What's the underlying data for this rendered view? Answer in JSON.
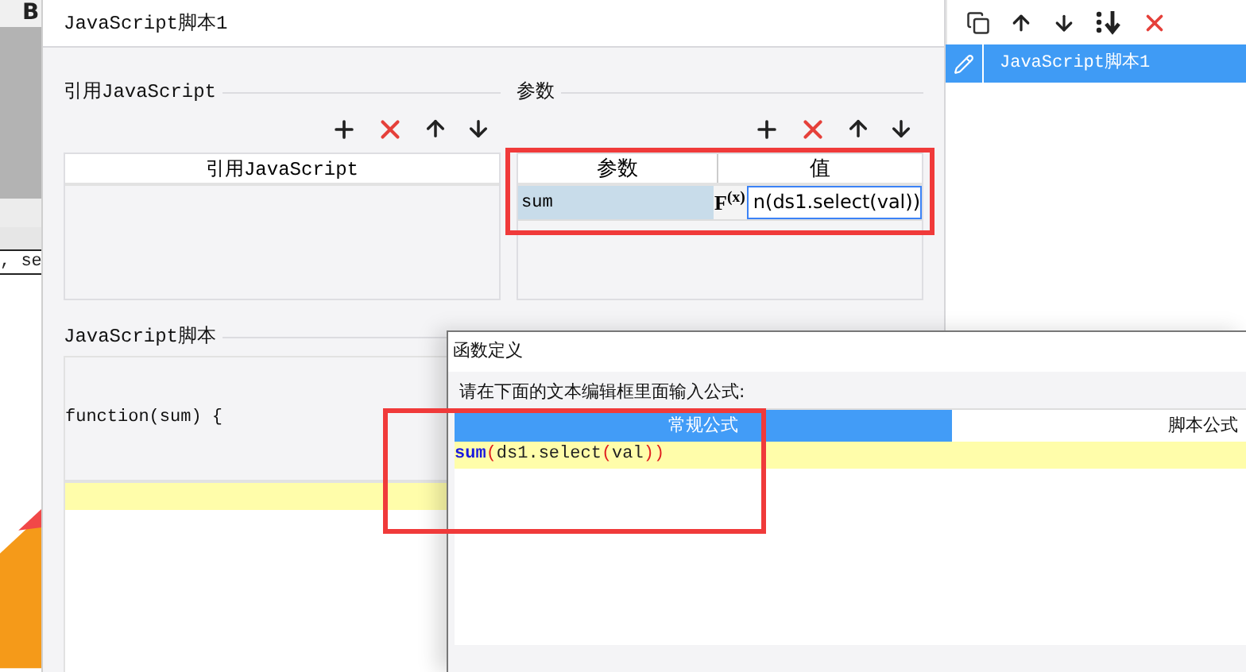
{
  "background_app": {
    "toolbar_letter": "B",
    "text_fragment": ", se"
  },
  "script_dialog": {
    "title": "JavaScript脚本1",
    "references": {
      "legend": "引用JavaScript",
      "columns": [
        "引用JavaScript"
      ]
    },
    "parameters": {
      "legend": "参数",
      "columns": [
        "参数",
        "值"
      ],
      "fx_label": "F$^{(x)}$",
      "rows": [
        {
          "name": "sum",
          "value": "n(ds1.select(val))",
          "selected": true
        }
      ]
    },
    "script": {
      "legend": "JavaScript脚本",
      "header_line": "function(sum) {"
    }
  },
  "script_list": {
    "items": [
      {
        "label": "JavaScript脚本1",
        "selected": true
      }
    ]
  },
  "formula_dialog": {
    "title": "函数定义",
    "prompt": "请在下面的文本编辑框里面输入公式:",
    "tabs": [
      {
        "label": "常规公式",
        "selected": true
      },
      {
        "label": "脚本公式",
        "selected": false
      }
    ],
    "code_tokens": [
      {
        "text": "sum",
        "kind": "keyword"
      },
      {
        "text": "(",
        "kind": "paren"
      },
      {
        "text": "ds1.select",
        "kind": "plain"
      },
      {
        "text": "(",
        "kind": "paren"
      },
      {
        "text": "val",
        "kind": "plain"
      },
      {
        "text": "))",
        "kind": "paren"
      }
    ]
  }
}
